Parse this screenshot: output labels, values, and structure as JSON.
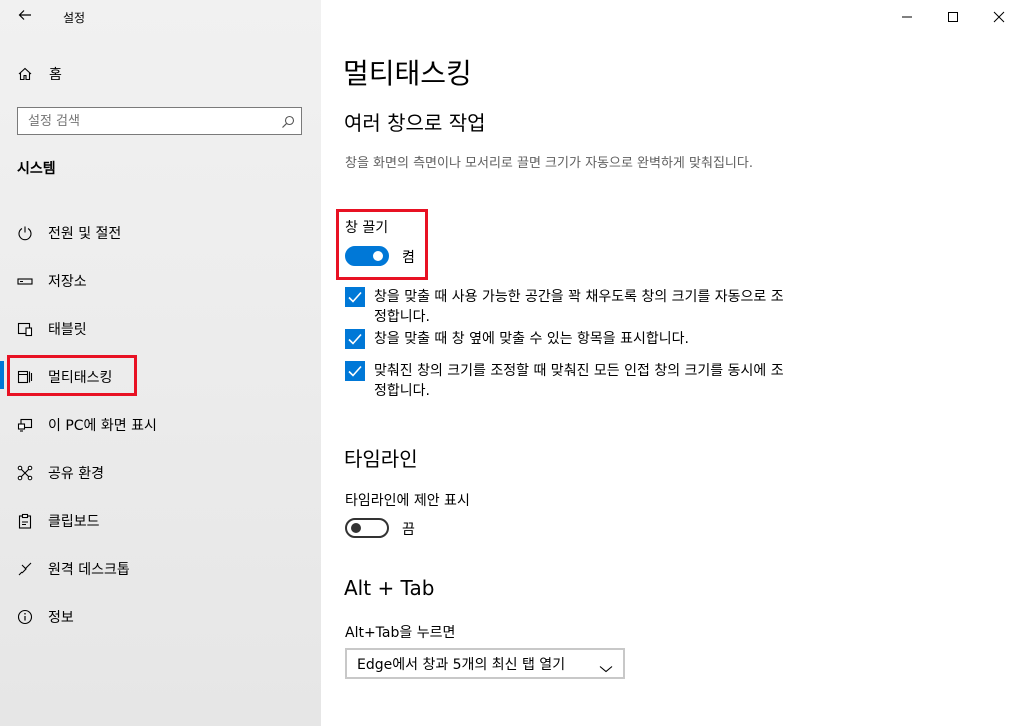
{
  "app": {
    "title": "설정",
    "back_icon": "back-arrow-icon"
  },
  "sidebar": {
    "home_label": "홈",
    "search_placeholder": "설정 검색",
    "section_title": "시스템",
    "items": [
      {
        "label": "전원 및 절전",
        "icon": "power-icon"
      },
      {
        "label": "저장소",
        "icon": "storage-icon"
      },
      {
        "label": "태블릿",
        "icon": "tablet-icon"
      },
      {
        "label": "멀티태스킹",
        "icon": "multitasking-icon"
      },
      {
        "label": "이 PC에 화면 표시",
        "icon": "project-icon"
      },
      {
        "label": "공유 환경",
        "icon": "shared-experiences-icon"
      },
      {
        "label": "클립보드",
        "icon": "clipboard-icon"
      },
      {
        "label": "원격 데스크톱",
        "icon": "remote-desktop-icon"
      },
      {
        "label": "정보",
        "icon": "info-icon"
      }
    ],
    "active_index": 3
  },
  "window_controls": {
    "minimize": "minimize-icon",
    "maximize": "maximize-icon",
    "close": "close-icon"
  },
  "main": {
    "page_title": "멀티태스킹",
    "snap": {
      "heading": "여러 창으로 작업",
      "description": "창을 화면의 측면이나 모서리로 끌면 크기가 자동으로 완벽하게 맞춰집니다.",
      "toggle_label": "창 끌기",
      "toggle_on": true,
      "toggle_state_text": "켬",
      "options": [
        {
          "text": "창을 맞출 때 사용 가능한 공간을 꽉 채우도록 창의 크기를 자동으로 조정합니다.",
          "checked": true
        },
        {
          "text": "창을 맞출 때 창 옆에 맞출 수 있는 항목을 표시합니다.",
          "checked": true
        },
        {
          "text": "맞춰진 창의 크기를 조정할 때 맞춰진 모든 인접 창의 크기를 동시에 조정합니다.",
          "checked": true
        }
      ]
    },
    "timeline": {
      "heading": "타임라인",
      "toggle_label": "타임라인에 제안 표시",
      "toggle_on": false,
      "toggle_state_text": "끔"
    },
    "alttab": {
      "heading": "Alt + Tab",
      "label": "Alt+Tab을 누르면",
      "selected": "Edge에서 창과 5개의 최신 탭 열기"
    }
  },
  "colors": {
    "accent": "#0078d7",
    "highlight": "#e81123"
  }
}
